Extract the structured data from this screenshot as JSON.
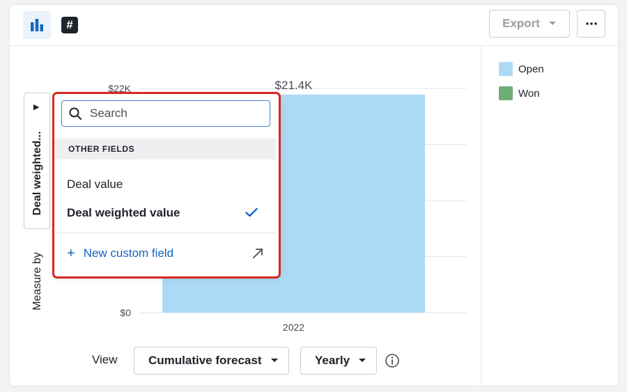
{
  "toolbar": {
    "chart_icon": "bar-chart-icon",
    "hash_icon": "hash-icon",
    "hash_glyph": "#",
    "export_label": "Export",
    "more_icon": "more-horizontal-icon"
  },
  "colors": {
    "open": "#acdaf5",
    "won": "#6dae78",
    "accent": "#1565c0",
    "highlight": "#d8281f"
  },
  "legend": [
    {
      "label": "Open",
      "color": "#acdaf5"
    },
    {
      "label": "Won",
      "color": "#6dae78"
    }
  ],
  "chart_data": {
    "type": "bar",
    "categories": [
      "2022"
    ],
    "series": [
      {
        "name": "Open",
        "values": [
          21400
        ]
      }
    ],
    "data_labels": [
      "$21.4K"
    ],
    "ylim": [
      0,
      22000
    ],
    "y_ticks_visible": [
      {
        "value": 22000,
        "label": "$22K"
      },
      {
        "value": 0,
        "label": "$0"
      }
    ],
    "grid": true,
    "legend_position": "right"
  },
  "measure": {
    "label": "Measure by",
    "value": "Deal weighted..."
  },
  "dropdown": {
    "search_placeholder": "Search",
    "section_title": "OTHER FIELDS",
    "options": [
      {
        "label": "Deal value",
        "selected": false
      },
      {
        "label": "Deal weighted value",
        "selected": true
      }
    ],
    "new_field_label": "New custom field"
  },
  "view": {
    "label": "View",
    "mode": "Cumulative forecast",
    "period": "Yearly"
  }
}
